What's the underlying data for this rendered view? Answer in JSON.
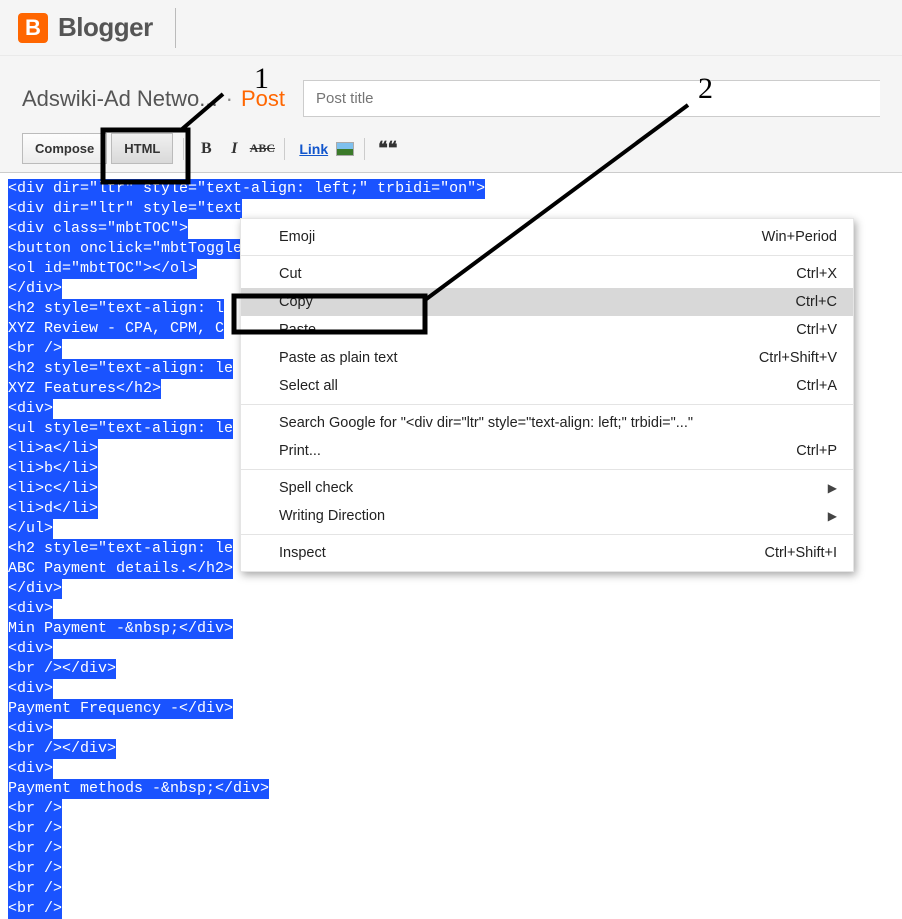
{
  "header": {
    "logo_letter": "B",
    "logo_text": "Blogger"
  },
  "post_bar": {
    "blog_title": "Adswiki-Ad Netwo...",
    "post_keyword": "Post",
    "title_placeholder": "Post title"
  },
  "toolbar": {
    "compose": "Compose",
    "html": "HTML",
    "bold": "B",
    "italic": "I",
    "strike": "ABC",
    "link": "Link",
    "quote": "❝❝"
  },
  "code_lines": [
    "<div dir=\"ltr\" style=\"text-align: left;\" trbidi=\"on\">",
    "<div dir=\"ltr\" style=\"text",
    "<div class=\"mbtTOC\">",
    "<button onclick=\"mbtToggle",
    "<ol id=\"mbtTOC\"></ol>",
    "</div>",
    "<h2 style=\"text-align: l",
    "XYZ Review - CPA, CPM, C",
    "<br />",
    "<h2 style=\"text-align: le",
    "XYZ Features</h2>",
    "<div>",
    "<ul style=\"text-align: le",
    "<li>a</li>",
    "<li>b</li>",
    "<li>c</li>",
    "<li>d</li>",
    "</ul>",
    "<h2 style=\"text-align: le",
    "ABC Payment details.</h2>",
    "</div>",
    "<div>",
    "Min Payment -&nbsp;</div>",
    "<div>",
    "<br /></div>",
    "<div>",
    "Payment Frequency -</div>",
    "<div>",
    "<br /></div>",
    "<div>",
    "Payment methods -&nbsp;</div>",
    "<br />",
    "<br />",
    "<br />",
    "<br />",
    "<br />",
    "<br />"
  ],
  "context_menu": {
    "items": [
      {
        "label": "Emoji",
        "shortcut": "Win+Period"
      },
      {
        "sep": true
      },
      {
        "label": "Cut",
        "shortcut": "Ctrl+X"
      },
      {
        "label": "Copy",
        "shortcut": "Ctrl+C",
        "highlighted": true
      },
      {
        "label": "Paste",
        "shortcut": "Ctrl+V"
      },
      {
        "label": "Paste as plain text",
        "shortcut": "Ctrl+Shift+V"
      },
      {
        "label": "Select all",
        "shortcut": "Ctrl+A"
      },
      {
        "sep": true
      },
      {
        "label": "Search Google for \"<div dir=\"ltr\" style=\"text-align: left;\" trbidi=\"...\"",
        "shortcut": ""
      },
      {
        "label": "Print...",
        "shortcut": "Ctrl+P"
      },
      {
        "sep": true
      },
      {
        "label": "Spell check",
        "submenu": true
      },
      {
        "label": "Writing Direction",
        "submenu": true
      },
      {
        "sep": true
      },
      {
        "label": "Inspect",
        "shortcut": "Ctrl+Shift+I"
      }
    ]
  },
  "annotations": {
    "label1": "1",
    "label2": "2"
  }
}
